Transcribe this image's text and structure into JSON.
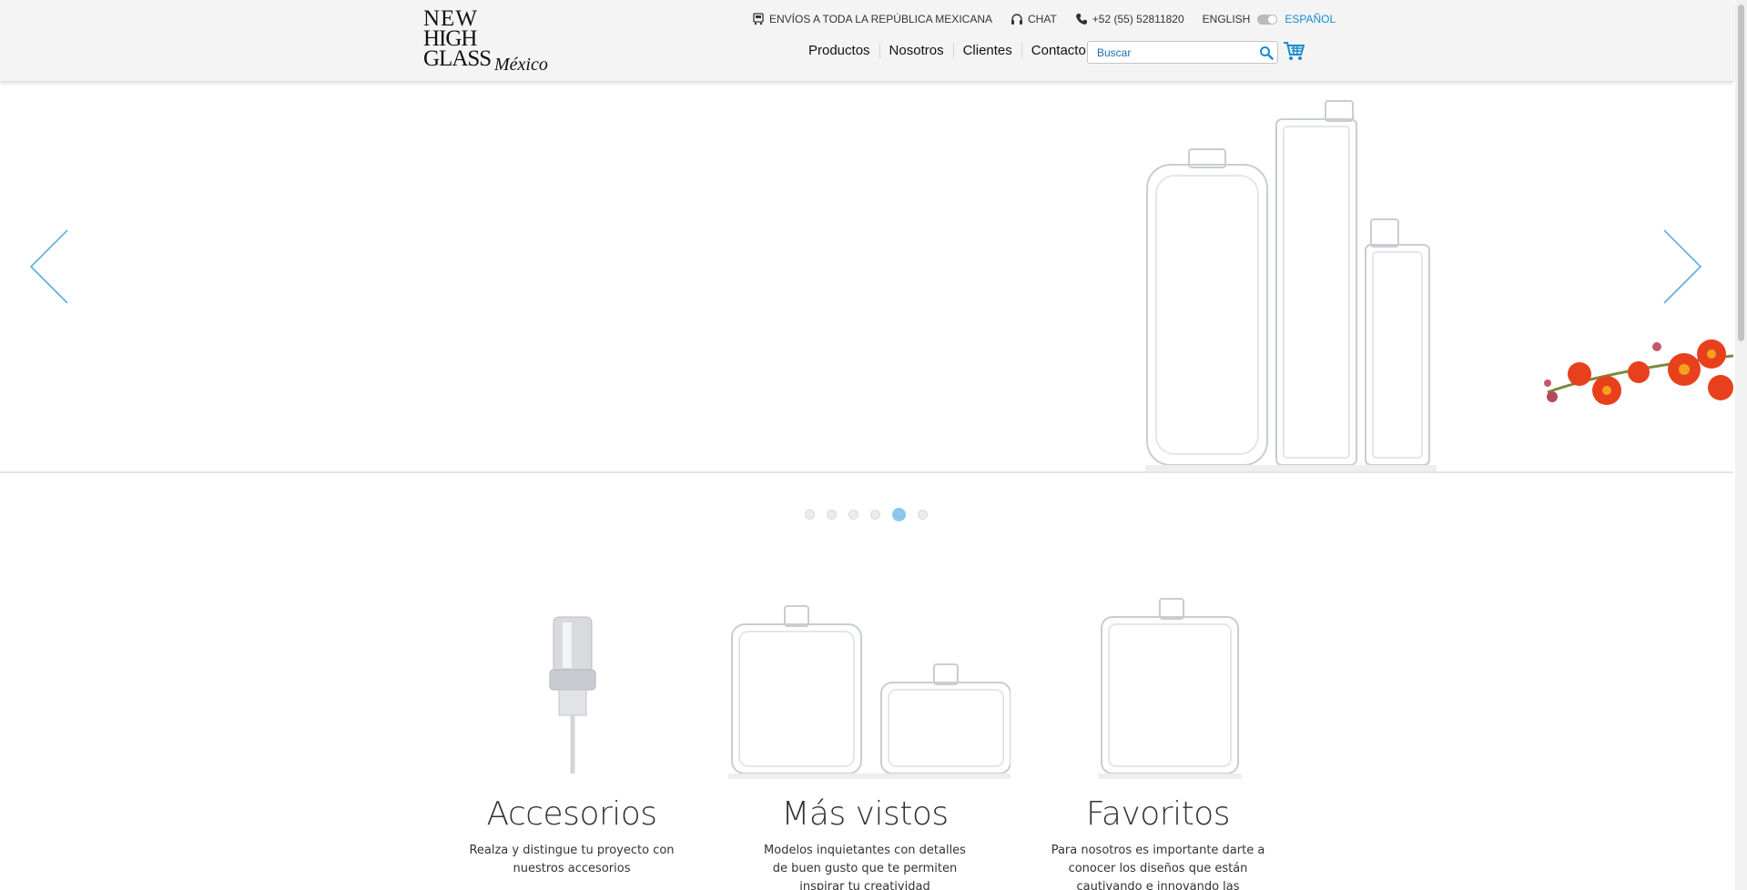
{
  "brand": {
    "logo_line1": "NEW",
    "logo_line2": "HIGH",
    "logo_line3": "GLASS",
    "logo_script": "México"
  },
  "topbar": {
    "shipping": "ENVÍOS A TODA LA REPÚBLICA MEXICANA",
    "chat": "CHAT",
    "phone": "+52 (55) 52811820",
    "lang_en": "ENGLISH",
    "lang_es": "ESPAÑOL"
  },
  "nav": {
    "items": [
      "Productos",
      "Nosotros",
      "Clientes",
      "Contacto"
    ]
  },
  "search": {
    "placeholder": "Buscar"
  },
  "slider": {
    "dot_count": 6,
    "active_dot": 5
  },
  "features": [
    {
      "title": "Accesorios",
      "text": "Realza y distingue tu proyecto con nuestros accesorios"
    },
    {
      "title": "Más vistos",
      "text": "Modelos inquietantes con detalles de buen gusto que te permiten inspirar tu creatividad"
    },
    {
      "title": "Favoritos",
      "text": "Para nosotros es importante darte a conocer los diseños que están cautivando e innovando las tendencias"
    }
  ],
  "colors": {
    "accent": "#1a8ccf",
    "arrow": "#5aaee0",
    "active_dot": "#8cc7ea"
  }
}
